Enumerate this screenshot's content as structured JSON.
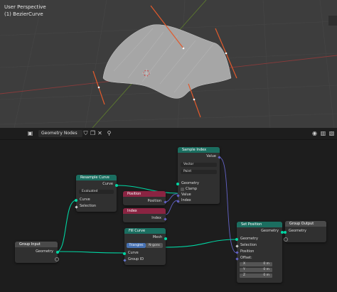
{
  "viewport": {
    "line1": "User Perspective",
    "line2": "(1) BezierCurve"
  },
  "header": {
    "tree_name": "Geometry Nodes",
    "icons": [
      "editor-type-icon",
      "node-tree-icon",
      "shield-icon",
      "copy-icon",
      "close-icon",
      "pin-icon",
      "toggle-icon",
      "overlay-icon",
      "view-icon"
    ]
  },
  "nodes": {
    "group_input": {
      "title": "Group Input",
      "out_geometry": "Geometry"
    },
    "resample": {
      "title": "Resample Curve",
      "out_curve": "Curve",
      "mode": "Evaluated",
      "in_curve": "Curve",
      "in_selection": "Selection"
    },
    "position": {
      "title": "Position",
      "out": "Position"
    },
    "index": {
      "title": "Index",
      "out": "Index"
    },
    "fill": {
      "title": "Fill Curve",
      "out_mesh": "Mesh",
      "btn_tri": "Triangles",
      "btn_ngon": "N-gons",
      "in_curve": "Curve",
      "in_group": "Group ID"
    },
    "sample": {
      "title": "Sample Index",
      "out_value": "Value",
      "type": "Vector",
      "domain": "Point",
      "in_geometry": "Geometry",
      "clamp": "Clamp",
      "in_value": "Value",
      "in_index": "Index"
    },
    "setpos": {
      "title": "Set Position",
      "out_geo": "Geometry",
      "in_geo": "Geometry",
      "in_sel": "Selection",
      "in_pos": "Position",
      "in_offset": "Offset:",
      "x": "X",
      "y": "Y",
      "z": "Z",
      "xv": "0 m",
      "yv": "0 m",
      "zv": "0 m"
    },
    "output": {
      "title": "Group Output",
      "in_geo": "Geometry"
    }
  }
}
